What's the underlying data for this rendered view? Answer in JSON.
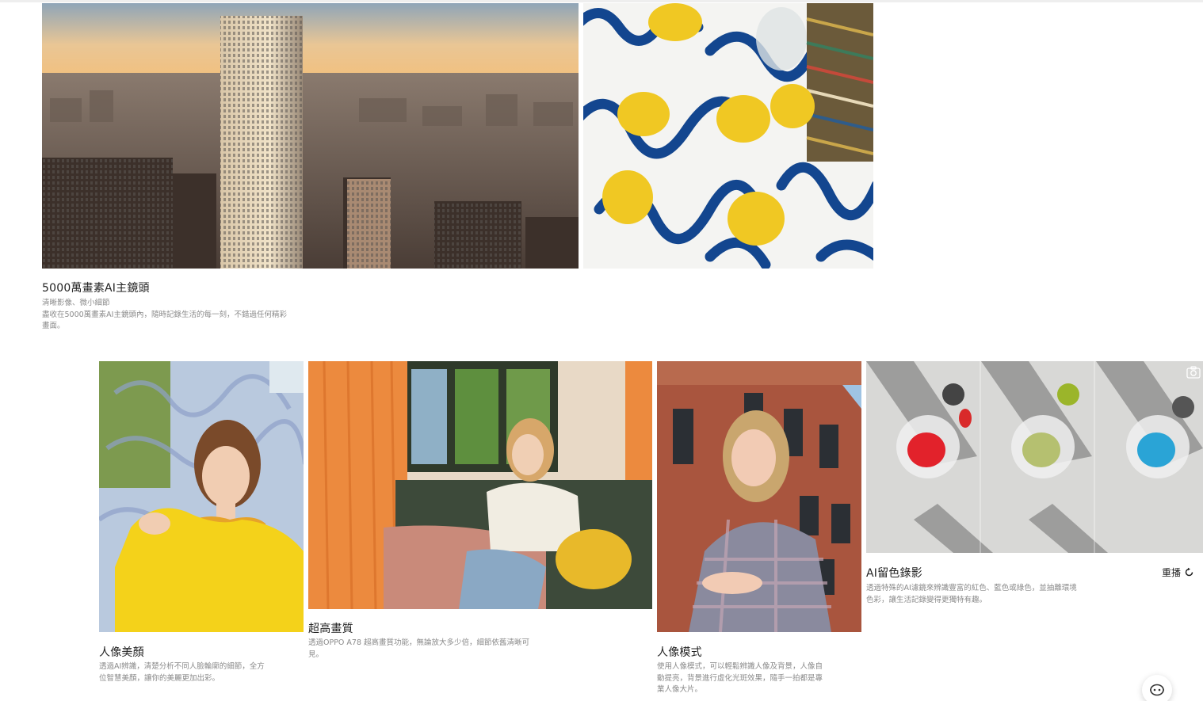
{
  "features": {
    "main_camera": {
      "title": "5000萬畫素AI主鏡頭",
      "line1": "清晰影像、微小細節",
      "line2": "盡收在5000萬畫素AI主鏡頭內，隨時記錄生活的每一刻，不錯過任何精彩畫面。"
    },
    "portrait_beauty": {
      "title": "人像美顏",
      "desc": "透過AI辨識，清楚分析不同人臉輪廓的細節，全方位智慧美顏，讓你的美麗更加出彩。"
    },
    "ultra_quality": {
      "title": "超高畫質",
      "desc": "透過OPPO A78 超高畫質功能，無論放大多少倍，細節依舊清晰可見。"
    },
    "portrait_mode": {
      "title": "人像模式",
      "desc": "使用人像模式，可以輕鬆辨識人像及背景，人像自動提亮，背景進行虛化光斑效果，隨手一拍都是專業人像大片。"
    },
    "ai_color": {
      "title": "AI留色錄影",
      "desc": "透過特殊的AI濾鏡來辨識豐富的紅色、藍色或綠色，並抽離環境色彩，讓生活記錄變得更獨特有趣。"
    }
  },
  "controls": {
    "replay_label": "重播"
  },
  "icons": {
    "replay": "replay-icon",
    "chat": "chat-assistant-icon",
    "camera": "camera-icon"
  }
}
